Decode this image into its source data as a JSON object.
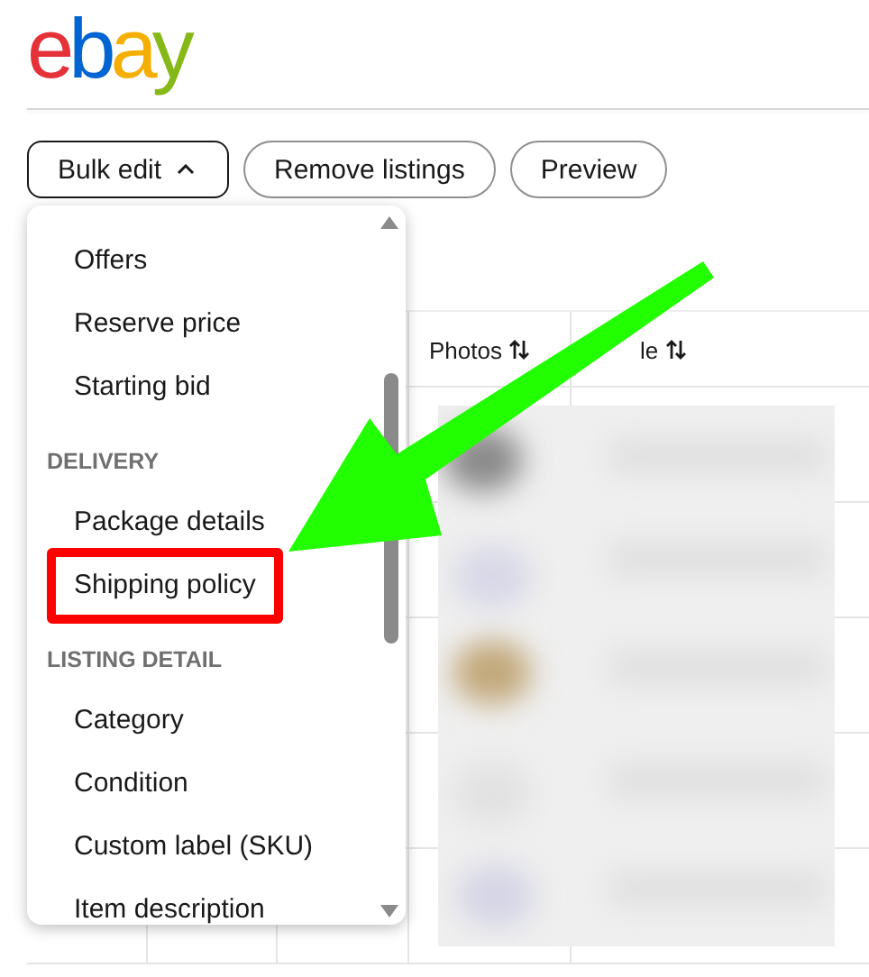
{
  "logo": {
    "letters": [
      {
        "char": "e",
        "color": "#e53238"
      },
      {
        "char": "b",
        "color": "#0064d2"
      },
      {
        "char": "a",
        "color": "#f5af02"
      },
      {
        "char": "y",
        "color": "#86b817"
      }
    ]
  },
  "toolbar": {
    "buttons": [
      {
        "label": "Bulk edit",
        "kind": "dropdown",
        "expanded": true
      },
      {
        "label": "Remove listings",
        "kind": "pill"
      },
      {
        "label": "Preview",
        "kind": "pill"
      }
    ]
  },
  "menu": {
    "items": [
      {
        "kind": "option",
        "label": "Offers",
        "highlighted": false
      },
      {
        "kind": "option",
        "label": "Reserve price",
        "highlighted": false
      },
      {
        "kind": "option",
        "label": "Starting bid",
        "highlighted": false
      },
      {
        "kind": "heading",
        "label": "DELIVERY"
      },
      {
        "kind": "option",
        "label": "Package details",
        "highlighted": false
      },
      {
        "kind": "option",
        "label": "Shipping policy",
        "highlighted": true
      },
      {
        "kind": "heading",
        "label": "LISTING DETAIL"
      },
      {
        "kind": "option",
        "label": "Category",
        "highlighted": false
      },
      {
        "kind": "option",
        "label": "Condition",
        "highlighted": false
      },
      {
        "kind": "option",
        "label": "Custom label (SKU)",
        "highlighted": false
      },
      {
        "kind": "option",
        "label": "Item description",
        "highlighted": false
      }
    ]
  },
  "table": {
    "columns": [
      {
        "label": "Photos",
        "sortable": true
      },
      {
        "label": "le",
        "sortable": true
      }
    ]
  },
  "annotations": {
    "arrow": true
  }
}
